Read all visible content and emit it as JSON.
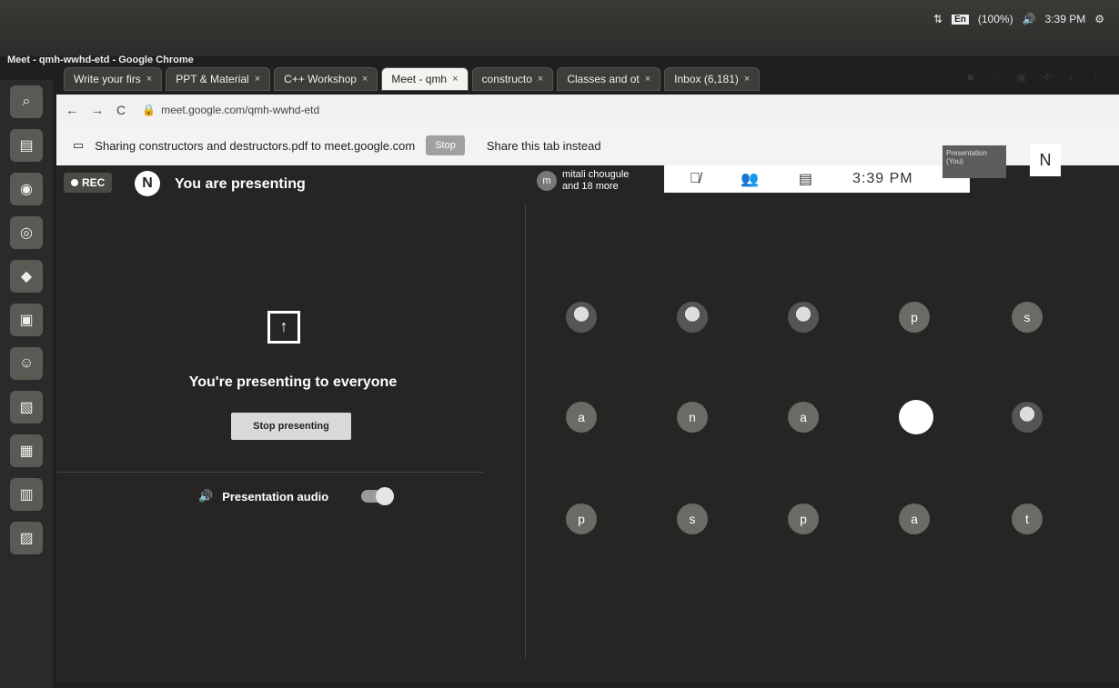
{
  "window": {
    "title": "Meet - qmh-wwhd-etd - Google Chrome"
  },
  "system": {
    "lang": "En",
    "battery": "(100%)",
    "clock": "3:39 PM"
  },
  "tabs": [
    {
      "label": "Write your firs",
      "active": false
    },
    {
      "label": "PPT & Material",
      "active": false
    },
    {
      "label": "C++ Workshop",
      "active": false
    },
    {
      "label": "Meet - qmh",
      "active": true
    },
    {
      "label": "constructo",
      "active": false
    },
    {
      "label": "Classes and ot",
      "active": false
    },
    {
      "label": "Inbox (6,181)",
      "active": false
    }
  ],
  "address": {
    "url": "meet.google.com/qmh-wwhd-etd"
  },
  "sharebar": {
    "text": "Sharing constructors and destructors.pdf to meet.google.com",
    "stop": "Stop",
    "instead": "Share this tab instead"
  },
  "meet": {
    "rec": "REC",
    "avatar": "N",
    "presenting": "You are presenting",
    "others_initial": "m",
    "others": "mitali chougule and 18 more",
    "time": "3:39 PM",
    "presentation_tile": "Presentation (You)",
    "self_avatar": "N",
    "title": "You're presenting to everyone",
    "stop_btn": "Stop presenting",
    "audio": "Presentation audio",
    "participants": [
      "",
      "",
      "",
      "p",
      "s",
      "a",
      "n",
      "a",
      "",
      "",
      "p",
      "s",
      "p",
      "a",
      "t"
    ]
  }
}
